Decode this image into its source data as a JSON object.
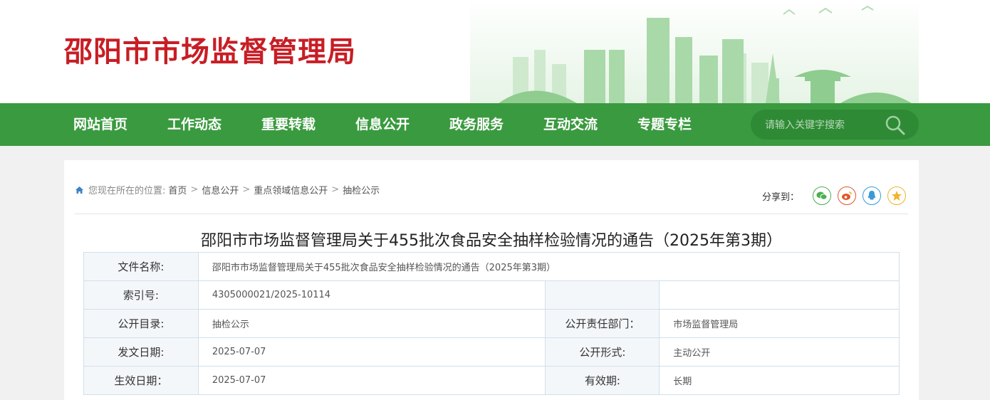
{
  "header": {
    "site_title": "邵阳市市场监督管理局"
  },
  "nav": {
    "items": [
      "网站首页",
      "工作动态",
      "重要转载",
      "信息公开",
      "政务服务",
      "互动交流",
      "专题专栏"
    ],
    "search_placeholder": "请输入关键字搜索"
  },
  "breadcrumb": {
    "prefix": "您现在所在的位置:",
    "items": [
      "首页",
      "信息公开",
      "重点领域信息公开",
      "抽检公示"
    ],
    "separator": ">"
  },
  "share": {
    "label": "分享到：",
    "targets": [
      "wechat-icon",
      "weibo-icon",
      "qq-icon",
      "qzone-icon"
    ]
  },
  "article": {
    "title": "邵阳市市场监督管理局关于455批次食品安全抽样检验情况的通告（2025年第3期）",
    "meta": {
      "doc_name_label": "文件名称:",
      "doc_name": "邵阳市市场监督管理局关于455批次食品安全抽样检验情况的通告（2025年第3期）",
      "index_label": "索引号:",
      "index": "4305000021/2025-10114",
      "catalog_label": "公开目录:",
      "catalog": "抽检公示",
      "dept_label": "公开责任部门：",
      "dept": "市场监督管理局",
      "date_label": "发文日期:",
      "date": "2025-07-07",
      "form_label": "公开形式:",
      "form": "主动公开",
      "effective_label": "生效日期：",
      "effective": "2025-07-07",
      "validity_label": "有效期:",
      "validity": "长期"
    }
  },
  "colors": {
    "brand_red": "#c81d25",
    "nav_green": "#3a9a3f"
  }
}
